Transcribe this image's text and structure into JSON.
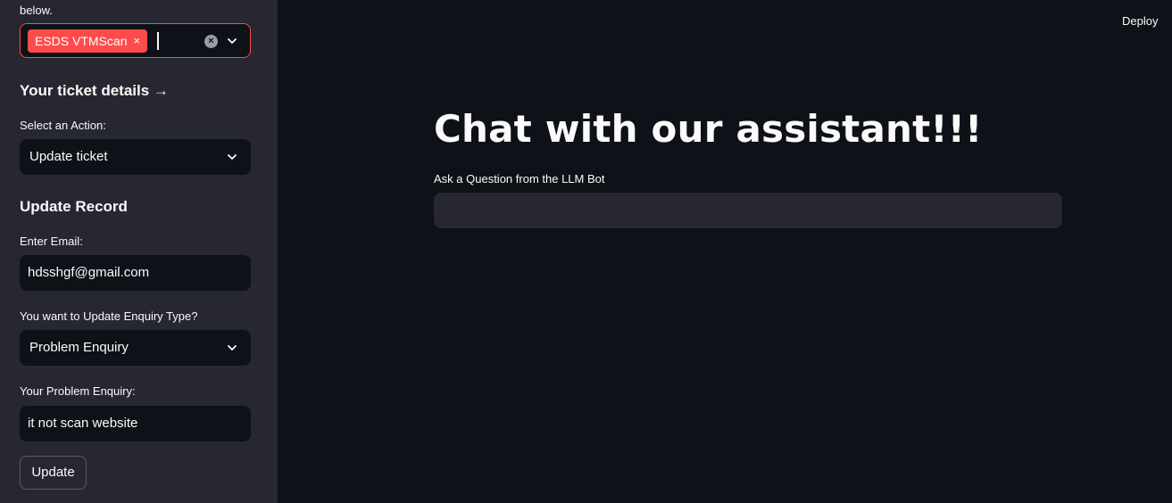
{
  "sidebar": {
    "intro_tail": "below.",
    "multiselect": {
      "tag": "ESDS VTMScan",
      "tag_remove": "×",
      "clear": "×"
    },
    "ticket_heading": "Your ticket details →",
    "action_label": "Select an Action:",
    "action_value": "Update ticket",
    "update_heading": "Update Record",
    "email_label": "Enter Email:",
    "email_value": "hdsshgf@gmail.com",
    "enquiry_type_label": "You want to Update Enquiry Type?",
    "enquiry_type_value": "Problem Enquiry",
    "problem_label": "Your Problem Enquiry:",
    "problem_value": "it not scan website",
    "update_button": "Update"
  },
  "header": {
    "deploy": "Deploy"
  },
  "main": {
    "title": "Chat with our assistant!!!",
    "question_label": "Ask a Question from the LLM Bot",
    "question_value": ""
  },
  "colors": {
    "sidebar_bg": "#262730",
    "main_bg": "#0e1117",
    "accent": "#ff4b4b"
  }
}
